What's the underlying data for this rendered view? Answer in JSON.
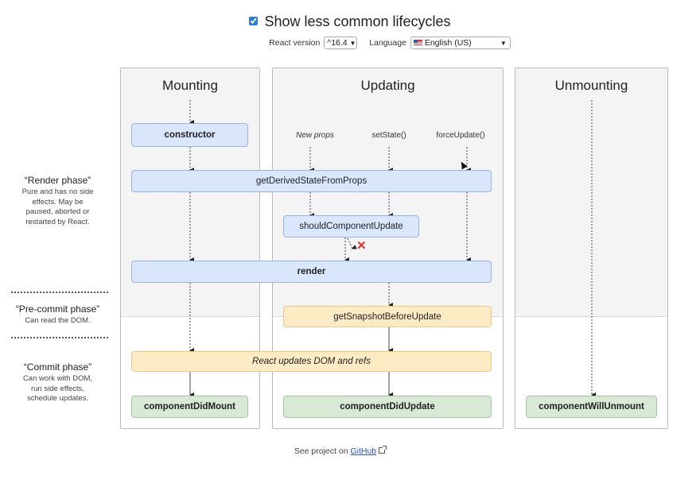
{
  "header": {
    "toggle_label": "Show less common lifecycles",
    "toggle_checked": true,
    "version_label": "React version",
    "version_value": "^16.4",
    "language_label": "Language",
    "language_value": "English (US)",
    "language_flag_icon": "us-flag-icon"
  },
  "phases": [
    {
      "title": "“Render phase”",
      "desc": [
        "Pure and has no side",
        "effects. May be",
        "paused, aborted or",
        "restarted by React."
      ]
    },
    {
      "title": "“Pre-commit phase”",
      "desc": [
        "Can read the DOM."
      ]
    },
    {
      "title": "“Commit phase”",
      "desc": [
        "Can work with DOM,",
        "run side effects,",
        "schedule updates."
      ]
    }
  ],
  "columns": {
    "mounting": "Mounting",
    "updating": "Updating",
    "unmounting": "Unmounting"
  },
  "triggers": {
    "new_props": "New props",
    "set_state": "setState()",
    "force_update": "forceUpdate()"
  },
  "methods": {
    "constructor": "constructor",
    "get_derived_state": "getDerivedStateFromProps",
    "should_update": "shouldComponentUpdate",
    "render": "render",
    "get_snapshot": "getSnapshotBeforeUpdate",
    "dom_update": "React updates DOM and refs",
    "did_mount": "componentDidMount",
    "did_update": "componentDidUpdate",
    "will_unmount": "componentWillUnmount"
  },
  "should_update_false_marker": "✕",
  "footer": {
    "prefix": "See project on",
    "link": "GitHub",
    "link_icon": "external-link-icon"
  }
}
